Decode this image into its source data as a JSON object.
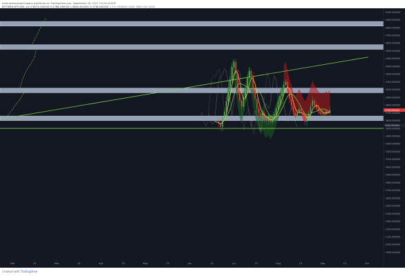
{
  "header": {
    "author_line": "tradingviewexperimagus published on TradingView.com, September 16, 2017 13:00:18 EDT",
    "symbol_line": "BITFINEX:BTCUSD, 4h",
    "ohlc_line": "O:3675.000000 H:3768.000000 L:3628.000000 C:3736.000000",
    "indicator_line": "1.5% GRNDUK  LEAD 3683  LAG 3640"
  },
  "footer": {
    "prefix": "Created with",
    "brand": "TradingView"
  },
  "chart_data": {
    "type": "line",
    "title": "",
    "price_axis": {
      "min": 1800,
      "max": 5050,
      "tick_step": 100,
      "tick_format": "0.000000",
      "current_price": 3736,
      "current_price_label": "3736.000000",
      "current_price_color": "#e53935",
      "secondary_tag": "3540.000000"
    },
    "time_axis": {
      "labels": [
        "Feb",
        "13",
        "Mar",
        "13",
        "Apr",
        "13",
        "May",
        "13",
        "Jun",
        "13",
        "Jul",
        "13",
        "Aug",
        "13",
        "Sep",
        "13",
        "Oct"
      ]
    },
    "support_resistance_zones": [
      {
        "name": "zone-1",
        "low": 4820,
        "high": 4880
      },
      {
        "name": "zone-2",
        "low": 4520,
        "high": 4580
      },
      {
        "name": "zone-3",
        "low": 3960,
        "high": 4020
      },
      {
        "name": "zone-4",
        "low": 3600,
        "high": 3660
      }
    ],
    "horizontal_line": {
      "price": 3500,
      "color": "#7cd34a"
    },
    "trendline": {
      "start": {
        "t": 0.0,
        "price": 3620
      },
      "end": {
        "t": 0.96,
        "price": 4420
      },
      "color": "#7cd34a"
    },
    "projection_paths": [
      {
        "points": [
          [
            0.02,
            3660
          ],
          [
            0.04,
            3800
          ],
          [
            0.05,
            3860
          ],
          [
            0.06,
            3940
          ],
          [
            0.07,
            3990
          ]
        ]
      },
      {
        "points": [
          [
            0.05,
            4000
          ],
          [
            0.06,
            4150
          ],
          [
            0.07,
            4260
          ],
          [
            0.08,
            4330
          ],
          [
            0.09,
            4420
          ],
          [
            0.095,
            4530
          ]
        ]
      },
      {
        "points": [
          [
            0.08,
            4540
          ],
          [
            0.09,
            4650
          ],
          [
            0.1,
            4740
          ],
          [
            0.11,
            4840
          ],
          [
            0.12,
            4920
          ]
        ]
      }
    ],
    "price_points": [
      {
        "t": 0.56,
        "price": 3590
      },
      {
        "t": 0.57,
        "price": 3560
      },
      {
        "t": 0.575,
        "price": 3520
      },
      {
        "t": 0.58,
        "price": 3640
      },
      {
        "t": 0.585,
        "price": 3720
      },
      {
        "t": 0.59,
        "price": 3850
      },
      {
        "t": 0.595,
        "price": 3980
      },
      {
        "t": 0.6,
        "price": 4130
      },
      {
        "t": 0.605,
        "price": 4290
      },
      {
        "t": 0.61,
        "price": 4360
      },
      {
        "t": 0.615,
        "price": 4200
      },
      {
        "t": 0.62,
        "price": 3980
      },
      {
        "t": 0.625,
        "price": 3860
      },
      {
        "t": 0.63,
        "price": 3780
      },
      {
        "t": 0.635,
        "price": 3900
      },
      {
        "t": 0.64,
        "price": 4010
      },
      {
        "t": 0.645,
        "price": 4150
      },
      {
        "t": 0.65,
        "price": 4240
      },
      {
        "t": 0.655,
        "price": 4180
      },
      {
        "t": 0.66,
        "price": 4000
      },
      {
        "t": 0.665,
        "price": 3880
      },
      {
        "t": 0.67,
        "price": 3760
      },
      {
        "t": 0.675,
        "price": 3700
      },
      {
        "t": 0.68,
        "price": 3640
      },
      {
        "t": 0.685,
        "price": 3700
      },
      {
        "t": 0.69,
        "price": 3620
      },
      {
        "t": 0.695,
        "price": 3600
      },
      {
        "t": 0.7,
        "price": 3640
      },
      {
        "t": 0.705,
        "price": 3580
      },
      {
        "t": 0.71,
        "price": 3620
      },
      {
        "t": 0.715,
        "price": 3680
      },
      {
        "t": 0.72,
        "price": 3760
      },
      {
        "t": 0.725,
        "price": 3840
      },
      {
        "t": 0.73,
        "price": 3920
      },
      {
        "t": 0.735,
        "price": 3980
      },
      {
        "t": 0.74,
        "price": 4060
      },
      {
        "t": 0.745,
        "price": 4100
      },
      {
        "t": 0.75,
        "price": 3980
      },
      {
        "t": 0.755,
        "price": 3880
      },
      {
        "t": 0.76,
        "price": 3790
      },
      {
        "t": 0.765,
        "price": 3700
      },
      {
        "t": 0.77,
        "price": 3660
      },
      {
        "t": 0.775,
        "price": 3700
      },
      {
        "t": 0.78,
        "price": 3750
      },
      {
        "t": 0.785,
        "price": 3700
      },
      {
        "t": 0.79,
        "price": 3640
      },
      {
        "t": 0.795,
        "price": 3590
      },
      {
        "t": 0.8,
        "price": 3640
      },
      {
        "t": 0.805,
        "price": 3700
      },
      {
        "t": 0.81,
        "price": 3780
      },
      {
        "t": 0.815,
        "price": 3860
      },
      {
        "t": 0.82,
        "price": 3800
      },
      {
        "t": 0.825,
        "price": 3760
      },
      {
        "t": 0.83,
        "price": 3720
      },
      {
        "t": 0.835,
        "price": 3690
      },
      {
        "t": 0.84,
        "price": 3700
      },
      {
        "t": 0.845,
        "price": 3680
      },
      {
        "t": 0.85,
        "price": 3720
      },
      {
        "t": 0.855,
        "price": 3700
      },
      {
        "t": 0.86,
        "price": 3736
      }
    ],
    "indicator_colors": {
      "candles_up": "#4caf50",
      "candles_down": "#e53935",
      "cloud_green": "#1b5e20",
      "cloud_red": "#b71c1c",
      "moving_average_yellow": "#ffd54f",
      "moving_average_green": "#7cd34a",
      "oscillator_grey": "#9e9e9e"
    }
  }
}
